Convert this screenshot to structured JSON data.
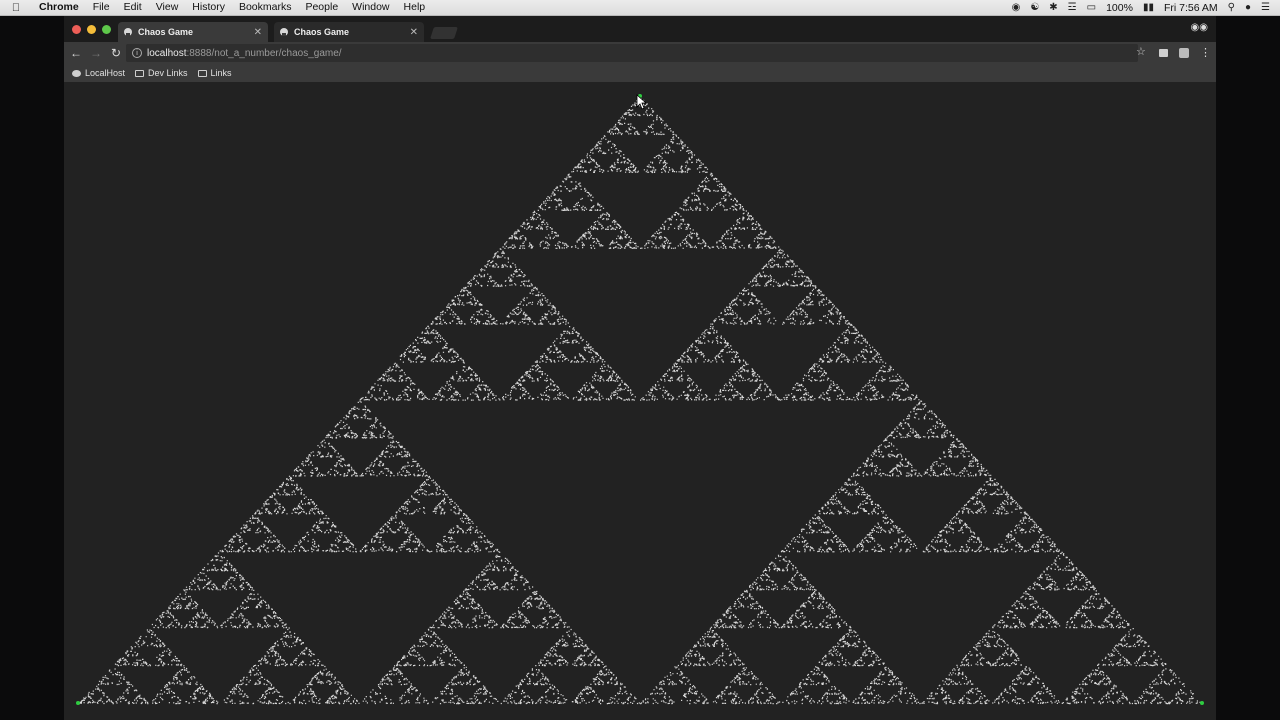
{
  "os_menubar": {
    "apple_icon": "apple-icon",
    "app_name": "Chrome",
    "menus": [
      "File",
      "Edit",
      "View",
      "History",
      "Bookmarks",
      "People",
      "Window",
      "Help"
    ],
    "battery": "100%",
    "clock": "Fri 7:56 AM"
  },
  "browser": {
    "tabs": [
      {
        "title": "Chaos Game",
        "active": true
      },
      {
        "title": "Chaos Game",
        "active": false
      }
    ],
    "address": {
      "host": "localhost",
      "path": ":8888/not_a_number/chaos_game/"
    },
    "bookmarks": [
      {
        "label": "LocalHost",
        "icon": "favicon-icon"
      },
      {
        "label": "Dev Links",
        "icon": "folder-icon"
      },
      {
        "label": "Links",
        "icon": "folder-icon"
      }
    ]
  },
  "canvas": {
    "background": "#222222",
    "point_color": "#ffffff",
    "vertex_color": "#2ecc40",
    "figure": "sierpinski-triangle"
  }
}
